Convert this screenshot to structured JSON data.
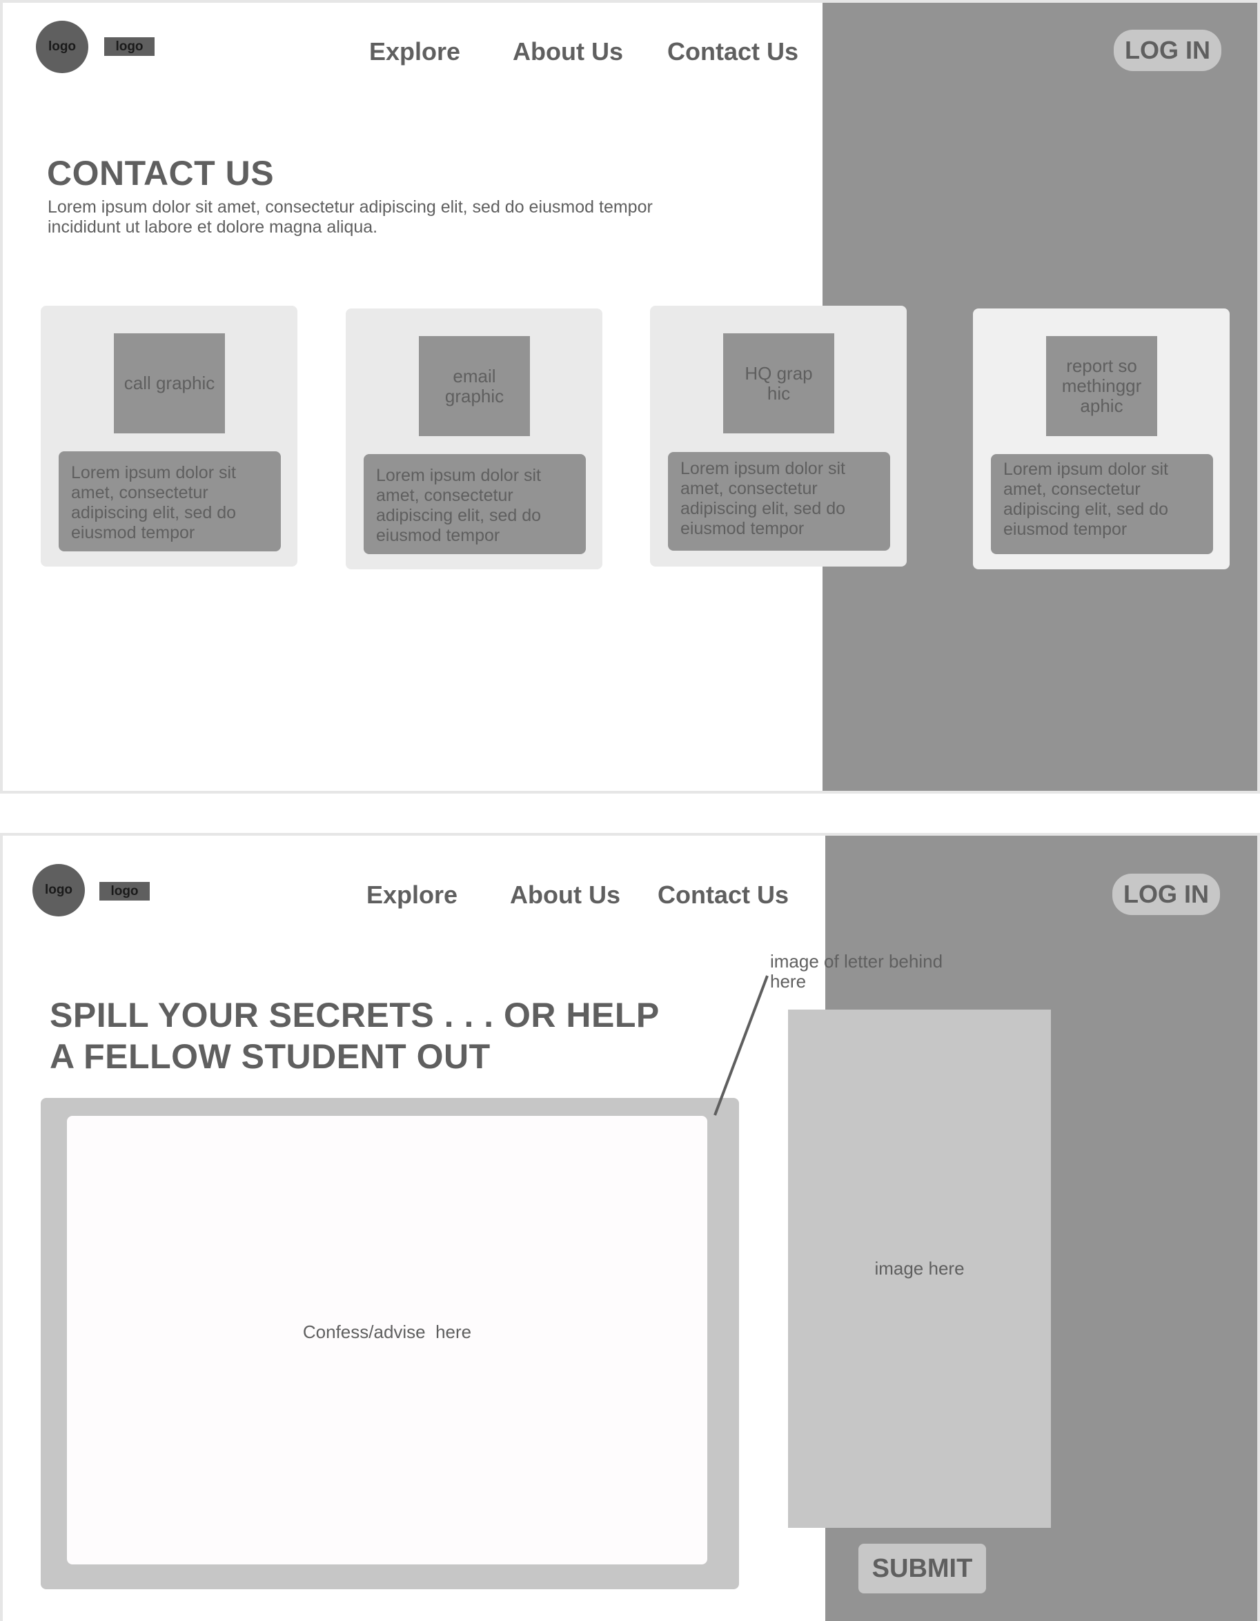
{
  "screen1": {
    "header": {
      "logo_circle": "logo",
      "logo_rect": "logo",
      "nav": [
        "Explore",
        "About Us",
        "Contact Us"
      ],
      "login": "LOG IN"
    },
    "title": "CONTACT US",
    "description_line1": "Lorem ipsum dolor sit amet, consectetur adipiscing elit, sed do eiusmod tempor",
    "description_line2": "incididunt ut labore et dolore magna aliqua.",
    "cards": [
      {
        "graphic": "call graphic",
        "text": "Lorem ipsum dolor sit amet, consectetur adipiscing elit, sed do eiusmod tempor"
      },
      {
        "graphic": "email graphic",
        "text": "Lorem ipsum dolor sit amet, consectetur adipiscing elit, sed do eiusmod tempor"
      },
      {
        "graphic": "HQ graphic",
        "text": "Lorem ipsum dolor sit amet, consectetur adipiscing elit, sed do eiusmod tempor"
      },
      {
        "graphic": "report somethinggraphic",
        "text": "Lorem ipsum dolor sit amet, consectetur adipiscing elit, sed do eiusmod tempor"
      }
    ]
  },
  "screen2": {
    "header": {
      "logo_circle": "logo",
      "logo_rect": "logo",
      "nav": [
        "Explore",
        "About Us",
        "Contact Us"
      ],
      "login": "LOG IN"
    },
    "title_line1": "SPILL YOUR SECRETS . . . OR HELP",
    "title_line2": "A FELLOW STUDENT OUT",
    "textarea_placeholder": "Confess/advise  here",
    "annotation": "image of letter behind here",
    "image_label": "image here",
    "submit": "SUBMIT"
  }
}
